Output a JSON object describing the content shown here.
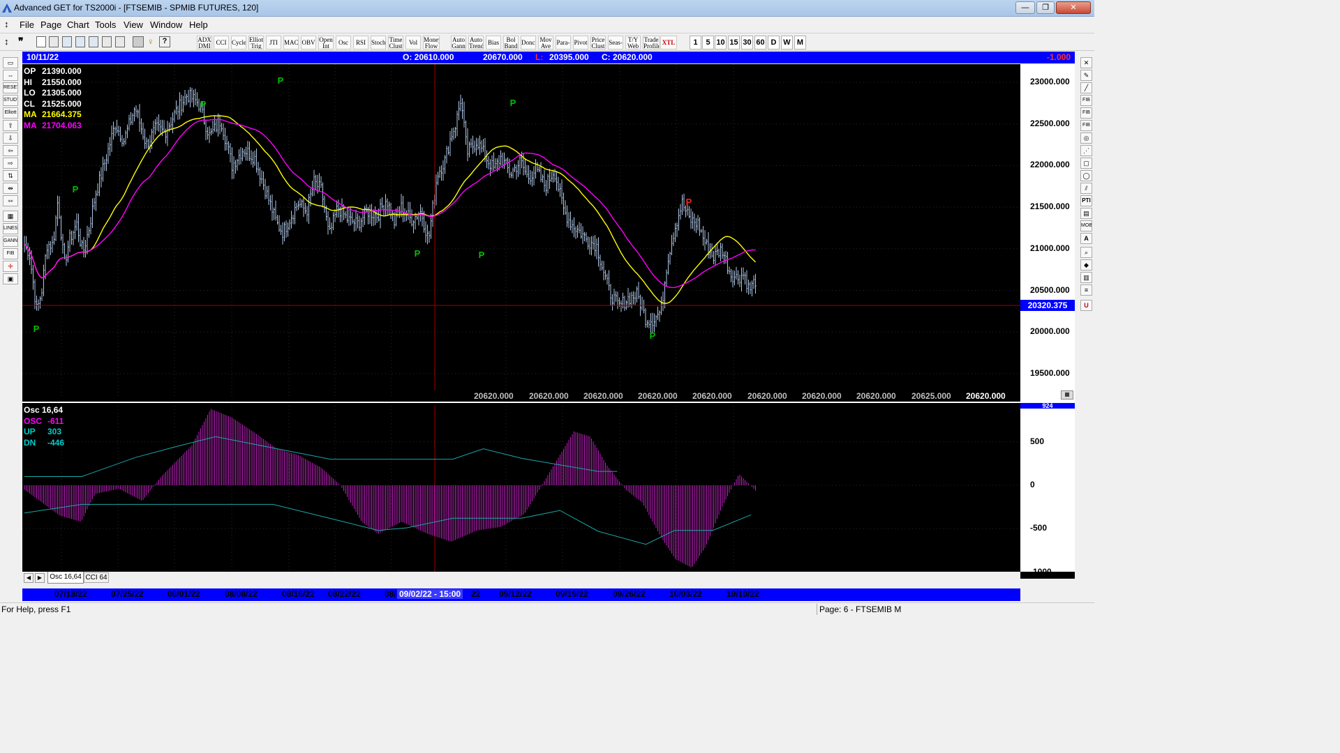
{
  "window": {
    "title": "Advanced GET for TS2000i - [FTSEMIB - SPMIB FUTURES, 120]",
    "min": "—",
    "max": "❐",
    "close": "✕"
  },
  "menu": [
    "File",
    "Page",
    "Chart",
    "Tools",
    "View",
    "Window",
    "Help"
  ],
  "mdi": {
    "min": "–",
    "restore": "❐",
    "close": "✕"
  },
  "toolbar_studies": [
    "ADX DMI",
    "CCI",
    "Cycles",
    "Elliott Trig",
    "JTI",
    "MACD",
    "OBV",
    "Open Int",
    "Osc",
    "RSI",
    "Stoch",
    "Time Clust",
    "Vol",
    "Money Flow",
    "Auto Gann",
    "Auto Trend",
    "Bias",
    "Bol Band",
    "Donch",
    "Mov Ave",
    "Para-bolic",
    "Pivot",
    "Price Clust",
    "Seas-onals",
    "T/Y Web",
    "Trade Profile",
    "XTL"
  ],
  "timeframes": [
    "1",
    "5",
    "10",
    "15",
    "30",
    "60",
    "D",
    "W",
    "M"
  ],
  "infobar": {
    "date": "10/11/22",
    "open": "O: 20610.000",
    "high": "20670.000",
    "low_label": "L:",
    "low": "20395.000",
    "close": "C: 20620.000",
    "change": "-1.000"
  },
  "price_legend": [
    {
      "label": "OP",
      "value": "21390.000",
      "color": "#ffffff"
    },
    {
      "label": "HI",
      "value": "21550.000",
      "color": "#ffffff"
    },
    {
      "label": "LO",
      "value": "21305.000",
      "color": "#ffffff"
    },
    {
      "label": "CL",
      "value": "21525.000",
      "color": "#ffffff"
    },
    {
      "label": "MA",
      "value": "21664.375",
      "color": "#ffff00"
    },
    {
      "label": "MA",
      "value": "21704.063",
      "color": "#ff00ff"
    }
  ],
  "price_axis": {
    "labels": [
      "23000.000",
      "22500.000",
      "22000.000",
      "21500.000",
      "21000.000",
      "20500.000",
      "20000.000",
      "19500.000"
    ],
    "cursor_value": "20320.375"
  },
  "bottom_values": [
    "20620.000",
    "20620.000",
    "20620.000",
    "20620.000",
    "20620.000",
    "20620.000",
    "20620.000",
    "20620.000",
    "20625.000",
    "20620.000"
  ],
  "pivot_marker": "P",
  "osc_legend": [
    {
      "label": "Osc 16,64",
      "value": "",
      "color": "#ffffff"
    },
    {
      "label": "OSC",
      "value": "-611",
      "color": "#ff00ff"
    },
    {
      "label": "UP",
      "value": "303",
      "color": "#00cccc"
    },
    {
      "label": "DN",
      "value": "-446",
      "color": "#00cccc"
    }
  ],
  "osc_axis": {
    "labels": [
      "500",
      "0",
      "-500",
      "-1000"
    ],
    "top_label": "924"
  },
  "tabs": [
    "Osc 16,64",
    "CCI 64"
  ],
  "dates": [
    "07/18/22",
    "07/25/22",
    "08/01/22",
    "08/08/22",
    "08/16/22",
    "08/22/22",
    "08/",
    "09/12/22",
    "09/19/22",
    "09/26/22",
    "10/03/22",
    "10/10/22"
  ],
  "cursor_date": "09/02/22 - 15:00",
  "cursor_date_tail": "22",
  "status": {
    "help": "For Help, press F1",
    "page": "Page: 6 - FTSEMIB M"
  },
  "colors": {
    "bars": "#b0c8e8",
    "ma_fast": "#ffff00",
    "ma_slow": "#ff00ff",
    "osc": "#c020c0",
    "bands": "#1aa7a7",
    "grid": "#333333",
    "cursor": "#a00000",
    "pivot_green": "#00c000",
    "pivot_red": "#ff2020"
  }
}
